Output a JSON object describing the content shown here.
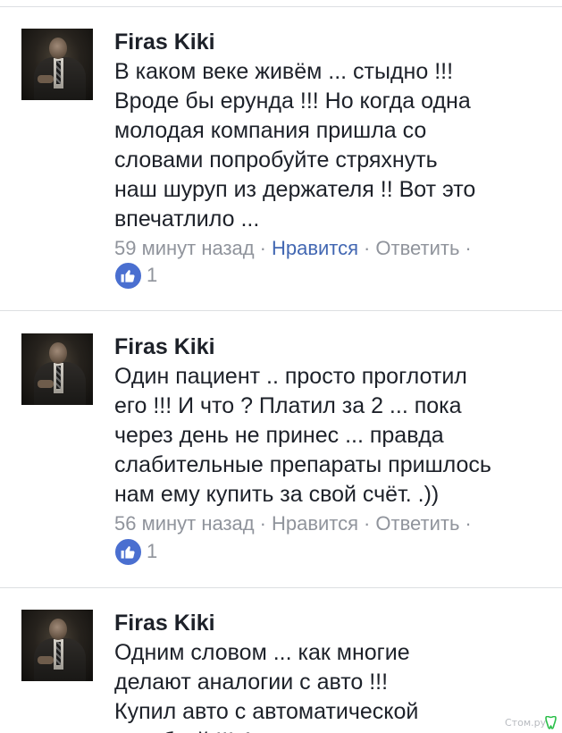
{
  "comments": [
    {
      "author": "Firas Kiki",
      "text": "В каком веке живём ... стыдно !!!\nВроде бы ерунда !!! Но когда одна\nмолодая компания пришла со\nсловами  попробуйте стряхнуть\nнаш шуруп из держателя !! Вот это\nвпечатлило ...",
      "time": "59 минут назад",
      "like_label": "Нравится",
      "like_active": true,
      "reply_label": "Ответить",
      "reaction_count": "1",
      "reaction_icon": "thumbs-up-icon"
    },
    {
      "author": "Firas Kiki",
      "text": "Один пациент .. просто проглотил\nего !!! И что ? Платил за 2 ... пока\nчерез день не принес ... правда\nслабительные препараты пришлось\nнам ему купить за свой счёт. .))",
      "time": "56 минут назад",
      "like_label": "Нравится",
      "like_active": false,
      "reply_label": "Ответить",
      "reaction_count": "1",
      "reaction_icon": "thumbs-up-icon"
    },
    {
      "author": "Firas Kiki",
      "text": "Одним словом ... как многие\nделают аналогии с авто !!!\nКупил авто с автоматической\nкоробкой !!! А при заключении",
      "reaction_icon": "thumbs-up-icon"
    }
  ],
  "meta_separator": "·",
  "watermark": "Стом.ру",
  "colors": {
    "author_text": "#1d2129",
    "meta_gray": "#90949c",
    "like_active": "#4267b2",
    "like_badge": "#4a6fd0",
    "divider": "#dddfe2",
    "watermark_icon": "#2bbf4a"
  }
}
